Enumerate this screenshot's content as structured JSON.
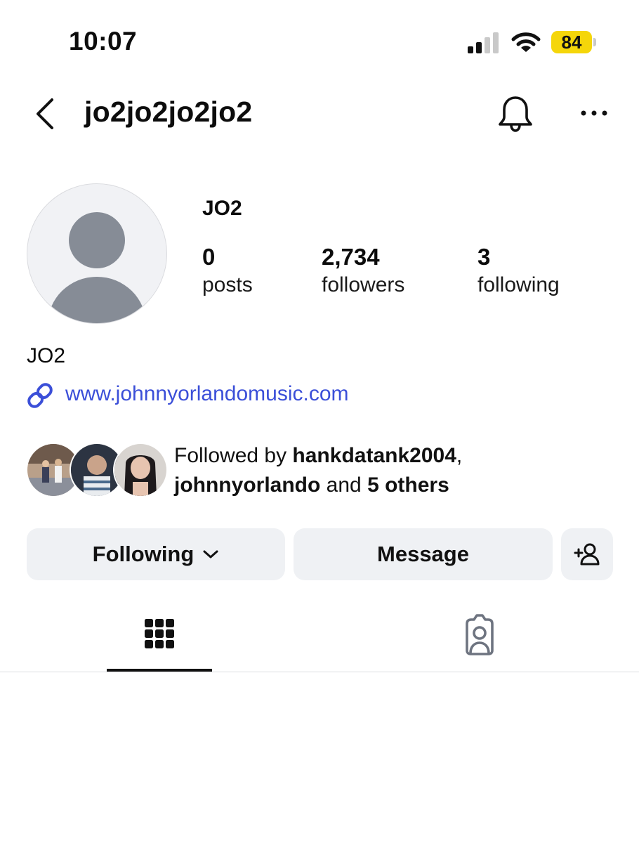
{
  "status_bar": {
    "time": "10:07",
    "battery_level": "84",
    "signal_bars_filled": 2,
    "signal_bars_total": 4
  },
  "header": {
    "username": "jo2jo2jo2jo2",
    "icons": [
      "chevron-left-icon",
      "bell-icon",
      "more-horizontal-icon"
    ]
  },
  "profile": {
    "display_name": "JO2",
    "stats": [
      {
        "value": "0",
        "label": "posts"
      },
      {
        "value": "2,734",
        "label": "followers"
      },
      {
        "value": "3",
        "label": "following"
      }
    ],
    "bio": "JO2",
    "website": "www.johnnyorlandomusic.com"
  },
  "followed_by": {
    "prefix": "Followed by ",
    "user1": "hankdatank2004",
    "separator": ",",
    "user2": "johnnyorlando",
    "and_text": " and ",
    "others": "5 others"
  },
  "actions": {
    "following_label": "Following",
    "message_label": "Message"
  },
  "tabs": [
    "grid-icon",
    "tagged-icon"
  ],
  "colors": {
    "link": "#3b4fd8",
    "button_bg": "#eff1f4",
    "battery": "#f5d60a"
  }
}
